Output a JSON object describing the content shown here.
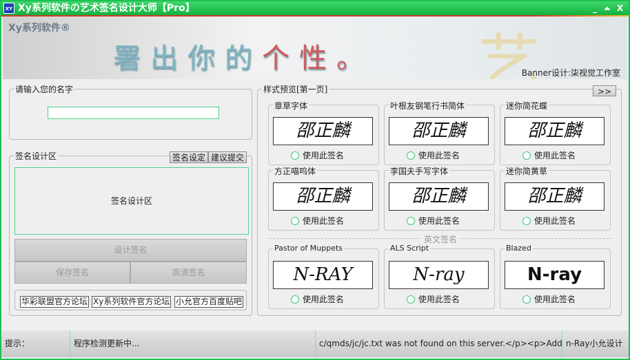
{
  "window": {
    "title": "Xy系列软件の艺术签名设计大师【Pro】",
    "logo": "XY",
    "minimize": "_",
    "maximize": "⏶",
    "close": "X"
  },
  "banner": {
    "brand": "Xy系列软件®",
    "slogan_a": "署出你的",
    "slogan_b": "个性。",
    "credit": "Banner设计:柒视觉工作室",
    "watermark": "艺"
  },
  "name_group": {
    "label": "请输入您的名字",
    "value": ""
  },
  "design_group": {
    "label": "签名设计区",
    "settings_button": "签名设定",
    "feedback_button": "建议提交",
    "canvas_text": "签名设计区",
    "design_button": "设计签名",
    "save_button": "保存签名",
    "hd_button": "高清签名",
    "links": [
      "华彩联盟官方论坛",
      "Xy系列软件官方论坛",
      "小允官方百度贴吧"
    ]
  },
  "preview_group": {
    "label": "样式预览[第一页]",
    "next_button": ">>",
    "radio_label": "使用此签名",
    "english_separator": "英文签名",
    "styles": [
      {
        "name": "章草字体",
        "sample": "邵正麟"
      },
      {
        "name": "叶根友钢笔行书简体",
        "sample": "邵正麟"
      },
      {
        "name": "迷你简花蝶",
        "sample": "邵正麟"
      },
      {
        "name": "方正喵呜体",
        "sample": "邵正麟"
      },
      {
        "name": "李国夫手写字体",
        "sample": "邵正麟"
      },
      {
        "name": "迷你简黄草",
        "sample": "邵正麟"
      },
      {
        "name": "Pastor of Muppets",
        "sample": "N-RAY"
      },
      {
        "name": "ALS Script",
        "sample": "N-ray"
      },
      {
        "name": "Blazed",
        "sample": "N-ray"
      }
    ]
  },
  "status": {
    "label": "提示：",
    "message": "程序检测更新中...",
    "error": "c/qmds/jc/jc.txt was not found on this server.</p><p>Addit",
    "author": "n-Ray小允设计"
  }
}
